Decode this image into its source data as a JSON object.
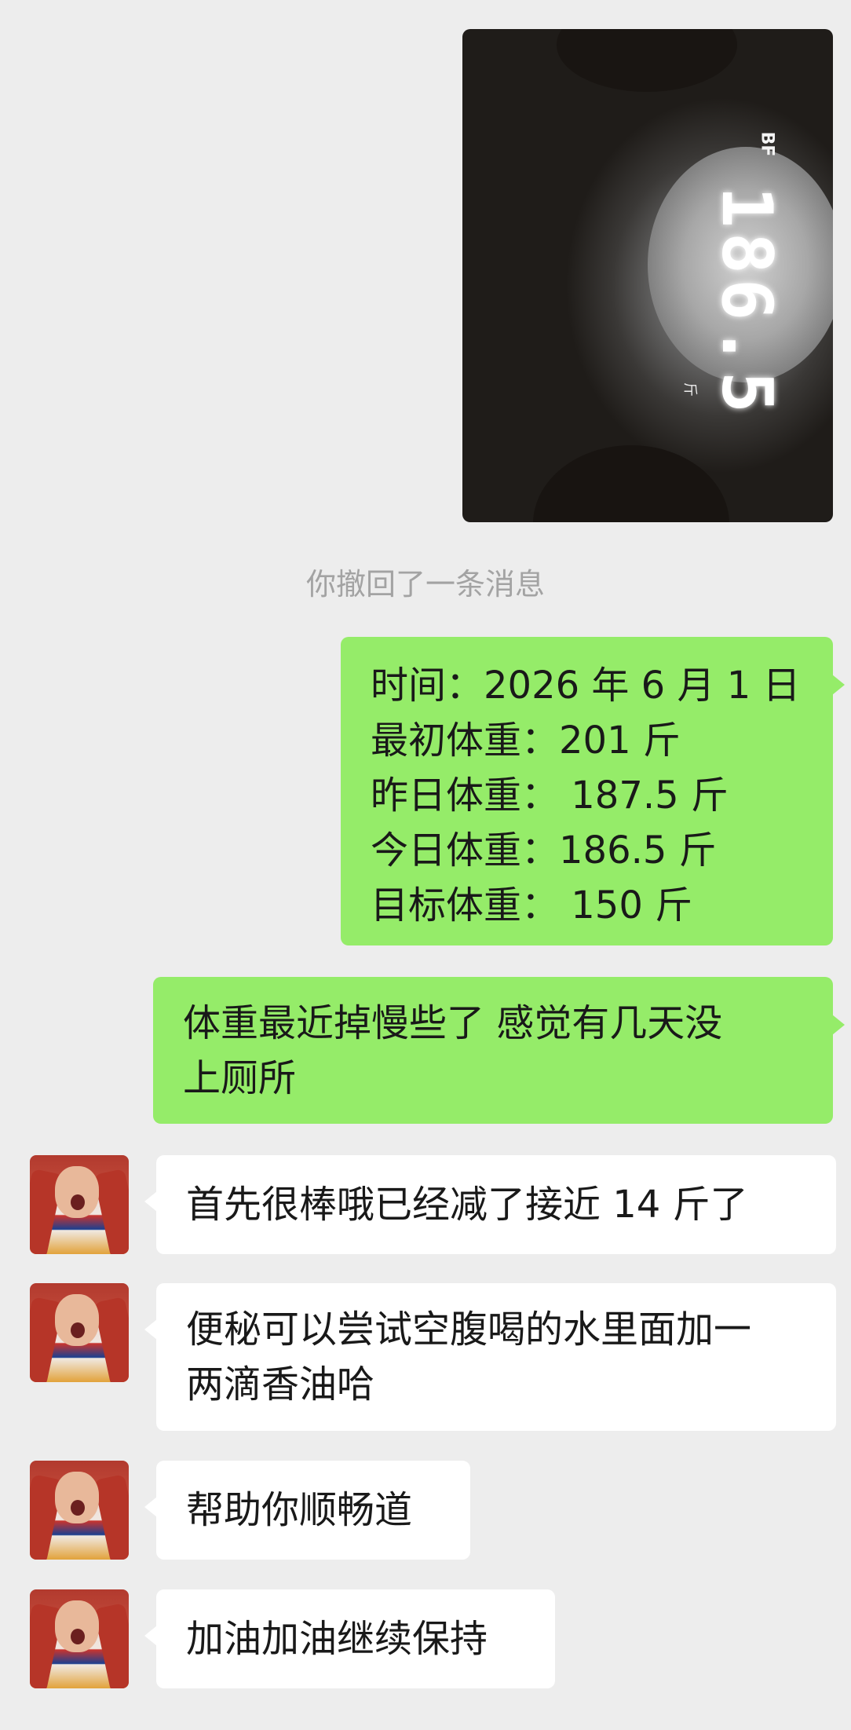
{
  "photo": {
    "readout": "186.5",
    "bf_label": "BF",
    "unit_label": "斤"
  },
  "system_notice": "你撤回了一条消息",
  "messages": [
    {
      "sender": "me",
      "lines": [
        "时间：2026 年 6 月 1 日",
        "最初体重：201 斤",
        "昨日体重： 187.5 斤",
        "今日体重：186.5 斤",
        "目标体重： 150 斤"
      ]
    },
    {
      "sender": "me",
      "lines": [
        "体重最近掉慢些了 感觉有几天没",
        "上厕所"
      ]
    },
    {
      "sender": "other",
      "lines": [
        "首先很棒哦已经减了接近 14 斤了"
      ]
    },
    {
      "sender": "other",
      "lines": [
        "便秘可以尝试空腹喝的水里面加一",
        "两滴香油哈"
      ]
    },
    {
      "sender": "other",
      "lines": [
        "帮助你顺畅道"
      ]
    },
    {
      "sender": "other",
      "lines": [
        "加油加油继续保持"
      ]
    }
  ],
  "colors": {
    "background": "#ededed",
    "my_bubble": "#95ec69",
    "other_bubble": "#ffffff",
    "notice_text": "#a3a3a3"
  }
}
